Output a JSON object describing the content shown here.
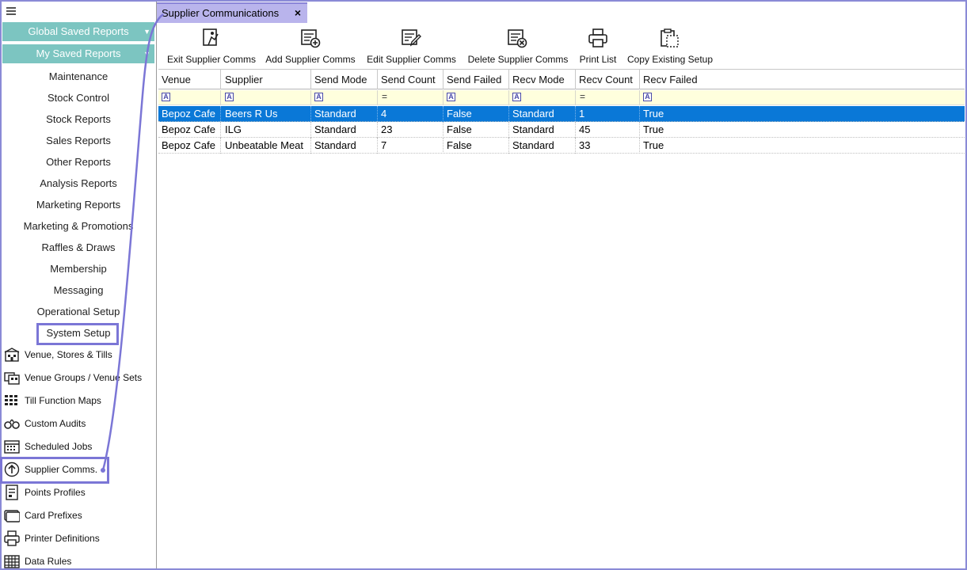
{
  "tab": {
    "title": "Supplier Communications",
    "close_glyph": "×"
  },
  "sidebar": {
    "menu_icon": "hamburger-icon",
    "report_buttons": [
      {
        "label": "Global Saved Reports"
      },
      {
        "label": "My Saved Reports"
      }
    ],
    "sections": [
      {
        "label": "Maintenance"
      },
      {
        "label": "Stock Control"
      },
      {
        "label": "Stock Reports"
      },
      {
        "label": "Sales Reports"
      },
      {
        "label": "Other Reports"
      },
      {
        "label": "Analysis Reports"
      },
      {
        "label": "Marketing Reports"
      },
      {
        "label": "Marketing & Promotions"
      },
      {
        "label": "Raffles & Draws"
      },
      {
        "label": "Membership"
      },
      {
        "label": "Messaging"
      },
      {
        "label": "Operational Setup"
      },
      {
        "label": "System Setup"
      }
    ],
    "items": [
      {
        "label": "Venue, Stores & Tills",
        "icon": "venue-icon"
      },
      {
        "label": "Venue Groups / Venue Sets",
        "icon": "venue-groups-icon"
      },
      {
        "label": "Till Function Maps",
        "icon": "grid-keys-icon"
      },
      {
        "label": "Custom Audits",
        "icon": "handcuffs-icon"
      },
      {
        "label": "Scheduled Jobs",
        "icon": "calendar-icon"
      },
      {
        "label": "Supplier Comms.",
        "icon": "upload-circle-icon"
      },
      {
        "label": "Points Profiles",
        "icon": "points-profile-icon"
      },
      {
        "label": "Card Prefixes",
        "icon": "card-icon"
      },
      {
        "label": "Printer Definitions",
        "icon": "printer-icon"
      },
      {
        "label": "Data Rules",
        "icon": "table-icon"
      }
    ]
  },
  "toolbar": {
    "buttons": [
      {
        "label": "Exit Supplier Comms",
        "icon": "exit-icon"
      },
      {
        "label": "Add Supplier Comms",
        "icon": "add-list-icon"
      },
      {
        "label": "Edit Supplier Comms",
        "icon": "edit-list-icon"
      },
      {
        "label": "Delete Supplier Comms",
        "icon": "delete-list-icon"
      },
      {
        "label": "Print List",
        "icon": "printer-icon"
      },
      {
        "label": "Copy Existing Setup",
        "icon": "copy-clipboard-icon"
      }
    ]
  },
  "grid": {
    "columns": [
      "Venue",
      "Supplier",
      "Send Mode",
      "Send Count",
      "Send Failed",
      "Recv Mode",
      "Recv Count",
      "Recv Failed"
    ],
    "filters": [
      "A",
      "A",
      "A",
      "=",
      "A",
      "A",
      "=",
      "A"
    ],
    "rows": [
      [
        "Bepoz Cafe",
        "Beers R Us",
        "Standard",
        "4",
        "False",
        "Standard",
        "1",
        "True"
      ],
      [
        "Bepoz Cafe",
        "ILG",
        "Standard",
        "23",
        "False",
        "Standard",
        "45",
        "True"
      ],
      [
        "Bepoz Cafe",
        "Unbeatable Meat",
        "Standard",
        "7",
        "False",
        "Standard",
        "33",
        "True"
      ]
    ],
    "selected_row": 0
  },
  "colors": {
    "accent": "#7b76d6",
    "sidebar_button": "#7cc5c1",
    "selected_row": "#0a78d7",
    "filter_row": "#ffffdd",
    "tab": "#b9b4ec"
  }
}
